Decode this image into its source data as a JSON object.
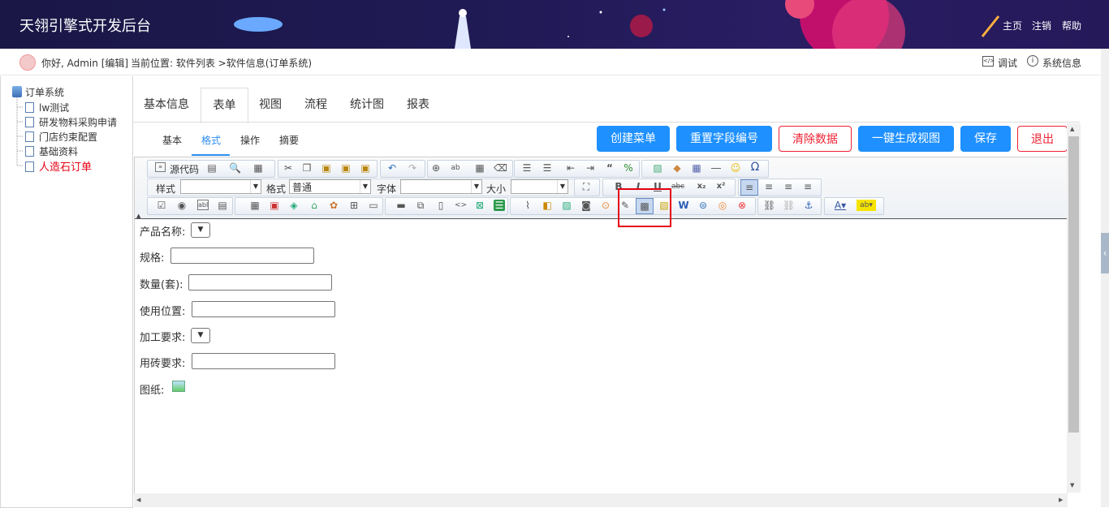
{
  "header": {
    "title": "天翎引擎式开发后台",
    "nav": [
      "主页",
      "注销",
      "帮助"
    ]
  },
  "subbar": {
    "greeting": "你好, Admin [编辑]",
    "location": "当前位置: 软件列表 >软件信息(订单系统)",
    "debug": "调试",
    "sysinfo": "系统信息"
  },
  "tree": {
    "root": "订单系统",
    "items": [
      "lw测试",
      "研发物料采购申请",
      "门店约束配置",
      "基础资料",
      "人造石订单"
    ],
    "active_color": "#e60012"
  },
  "main_tabs": [
    "基本信息",
    "表单",
    "视图",
    "流程",
    "统计图",
    "报表"
  ],
  "sub_tabs": [
    "基本",
    "格式",
    "操作",
    "摘要"
  ],
  "buttons": {
    "create_menu": "创建菜单",
    "reset_field": "重置字段编号",
    "clear_data": "清除数据",
    "gen_view": "一键生成视图",
    "save": "保存",
    "exit": "退出"
  },
  "toolbar": {
    "source": "源代码",
    "style_label": "样式",
    "format_label": "格式",
    "format_value": "普通",
    "font_label": "字体",
    "size_label": "大小"
  },
  "form": {
    "product_name": "产品名称:",
    "spec": "规格:",
    "quantity": "数量(套):",
    "position": "使用位置:",
    "processing": "加工要求:",
    "brick": "用砖要求:",
    "drawing": "图纸:"
  },
  "colors": {
    "accent": "#1e90ff",
    "danger": "#e23",
    "highlight": "#e60012"
  }
}
